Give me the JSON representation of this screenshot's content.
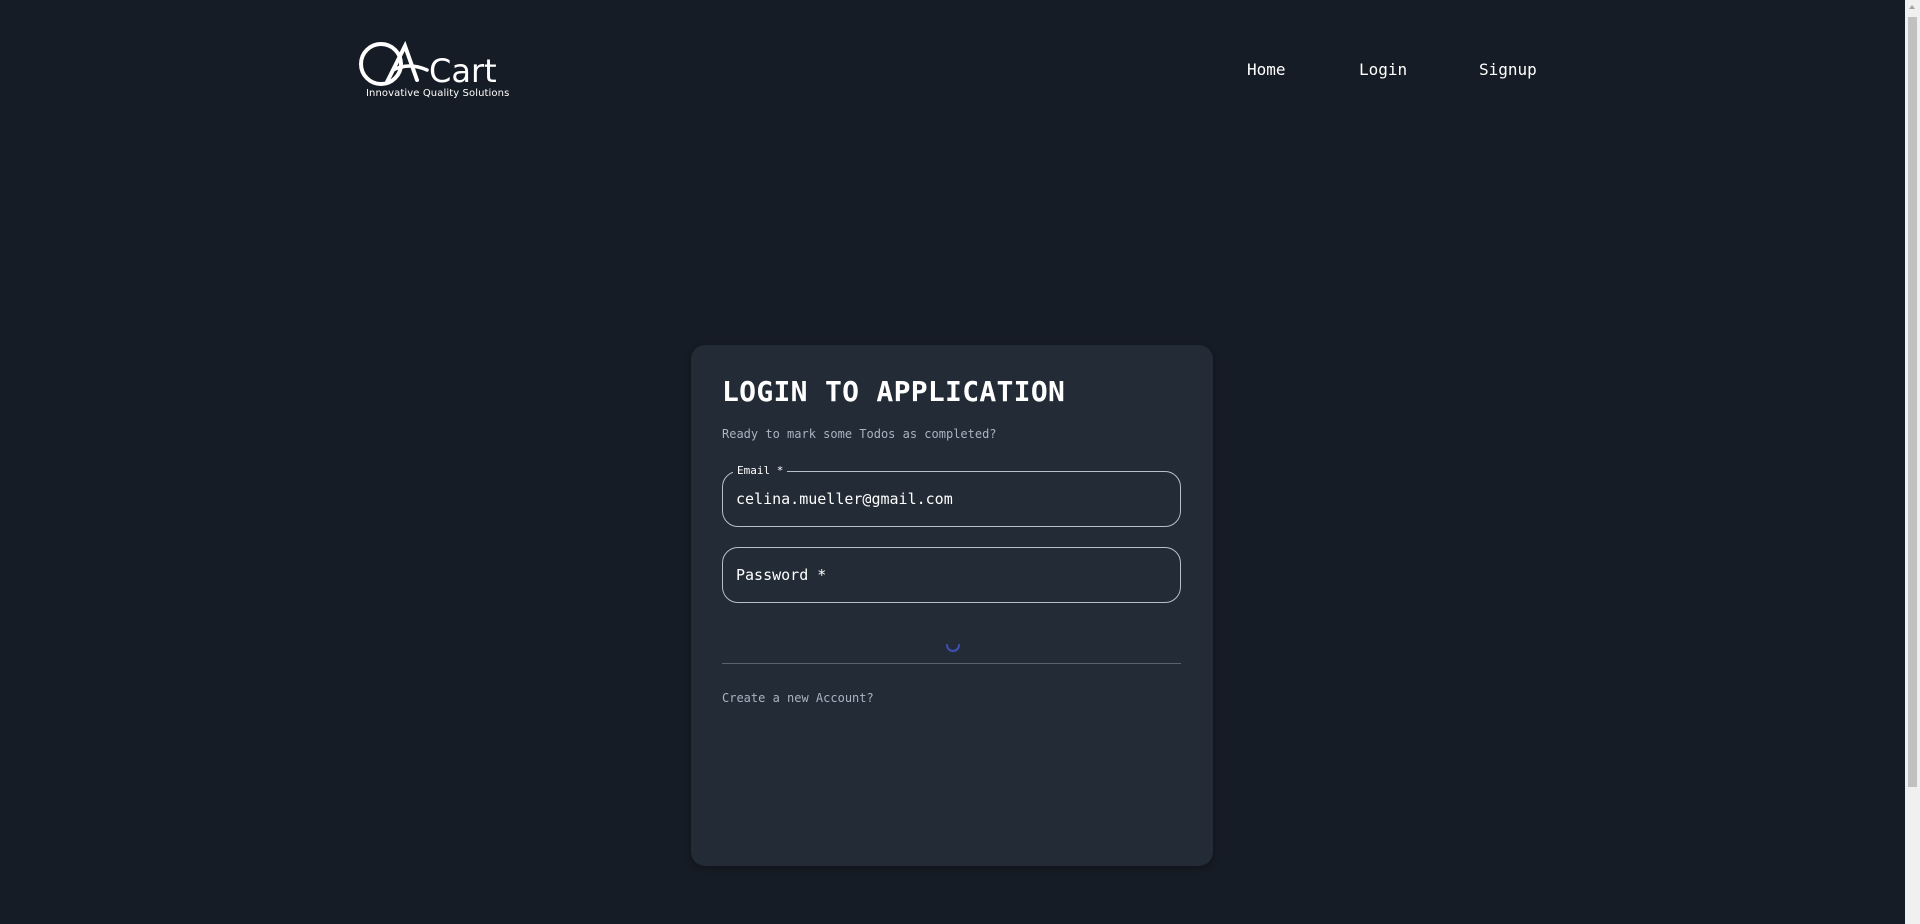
{
  "header": {
    "logo": {
      "brand": "QACart",
      "tagline": "Innovative Quality Solutions"
    },
    "nav": [
      {
        "label": "Home"
      },
      {
        "label": "Login"
      },
      {
        "label": "Signup"
      }
    ]
  },
  "login_card": {
    "title": "LOGIN TO APPLICATION",
    "subtitle": "Ready to mark some Todos as completed?",
    "email": {
      "label": "Email *",
      "value": "celina.mueller@gmail.com"
    },
    "password": {
      "placeholder": "Password *",
      "value": ""
    },
    "create_account_link": "Create a new Account?"
  },
  "colors": {
    "background": "#161c25",
    "card": "#222b36",
    "spinner": "#3f51b5",
    "muted_text": "#a9b3c1"
  }
}
